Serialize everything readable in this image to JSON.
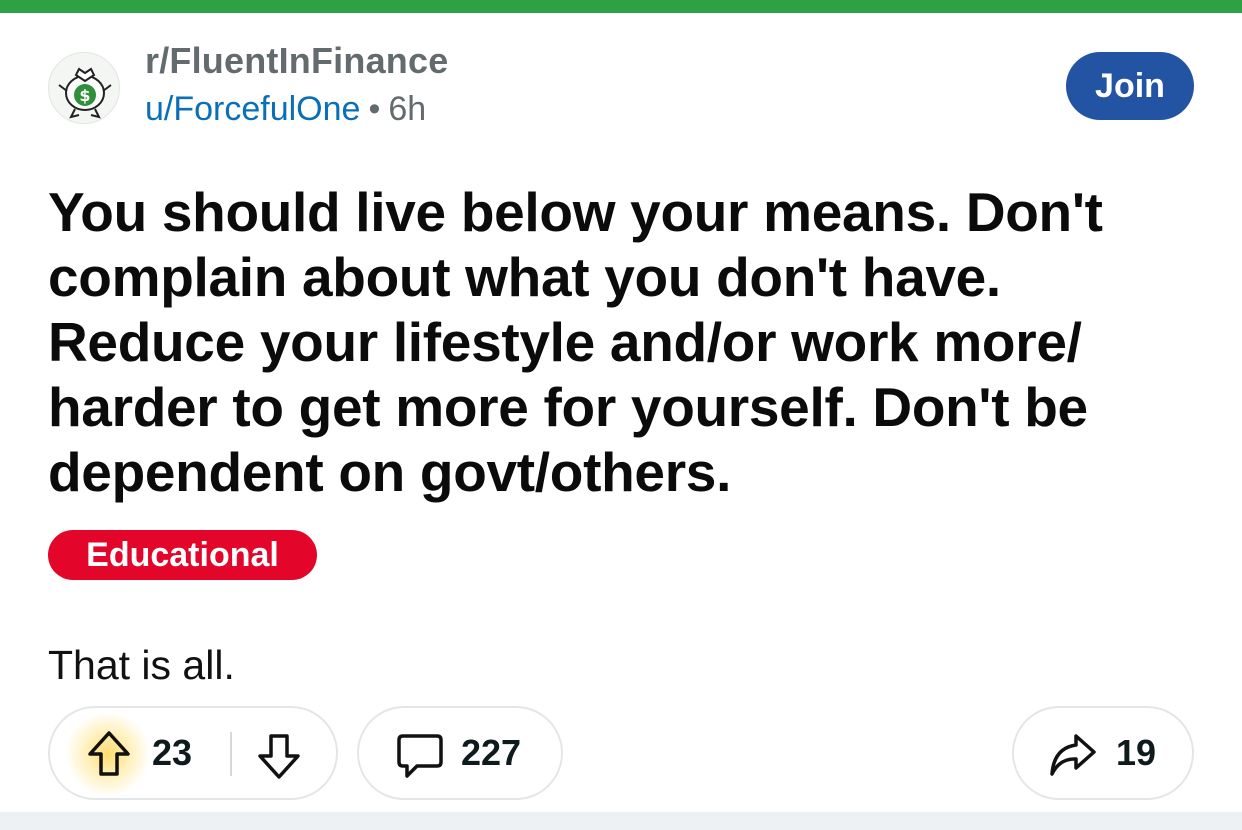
{
  "post": {
    "subreddit": "r/FluentInFinance",
    "author": "u/ForcefulOne",
    "separator": "•",
    "age": "6h",
    "join_label": "Join",
    "title": "You should live below your means. Don't complain about what you don't have. Reduce your lifestyle and/or work more/ harder to get more for yourself. Don't be dependent on govt/others.",
    "flair": "Educational",
    "body": "That is all."
  },
  "actions": {
    "score": "23",
    "comments": "227",
    "shares": "19"
  },
  "icons": {
    "avatar": "money-bag-icon",
    "upvote": "upvote-arrow-icon",
    "downvote": "downvote-arrow-icon",
    "comment": "comment-bubble-icon",
    "share": "share-arrow-icon"
  },
  "colors": {
    "top_bar": "#2fa043",
    "join_button": "#2354a3",
    "flair": "#e3052a",
    "username": "#0b6fb8"
  }
}
